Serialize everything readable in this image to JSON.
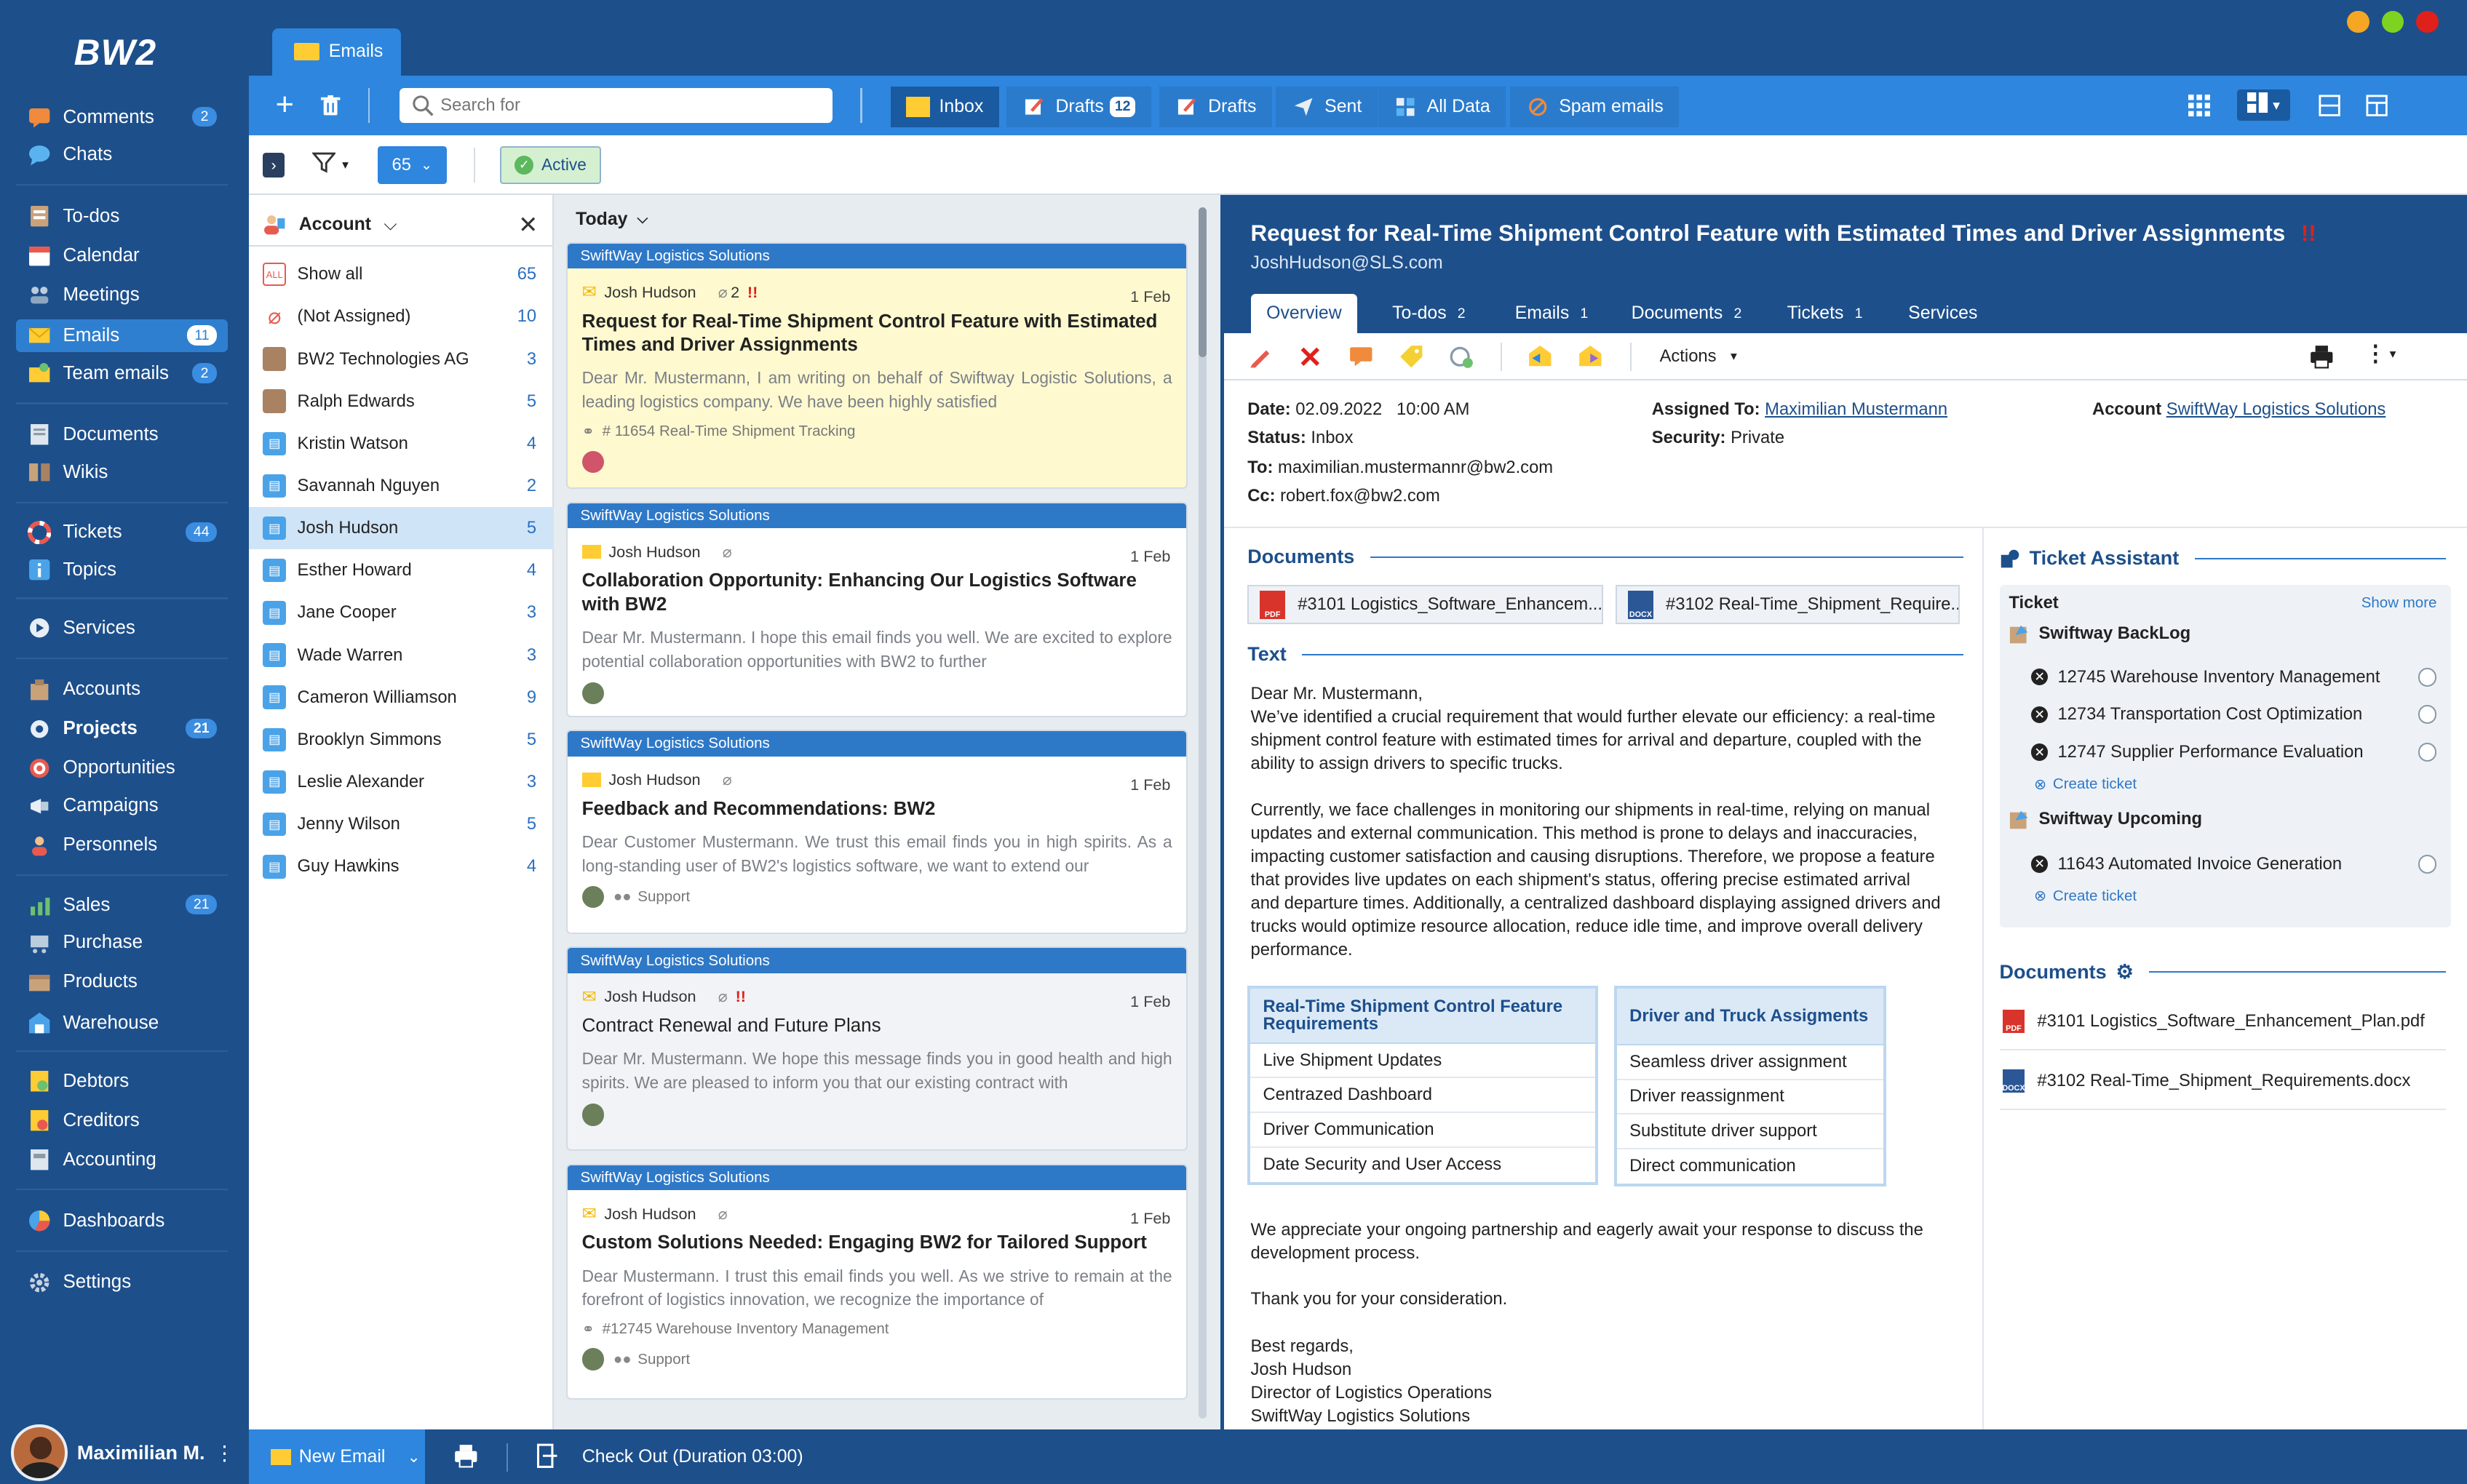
{
  "app": {
    "logo": "BW2",
    "window_tab": "Emails"
  },
  "sidebar": {
    "items": [
      {
        "label": "Comments",
        "count": "2"
      },
      {
        "label": "Chats",
        "count": ""
      },
      {
        "label": "To-dos",
        "count": ""
      },
      {
        "label": "Calendar",
        "count": ""
      },
      {
        "label": "Meetings",
        "count": ""
      },
      {
        "label": "Emails",
        "count": "11"
      },
      {
        "label": "Team emails",
        "count": "2"
      },
      {
        "label": "Documents",
        "count": ""
      },
      {
        "label": "Wikis",
        "count": ""
      },
      {
        "label": "Tickets",
        "count": "44"
      },
      {
        "label": "Topics",
        "count": ""
      },
      {
        "label": "Services",
        "count": ""
      },
      {
        "label": "Accounts",
        "count": ""
      },
      {
        "label": "Projects",
        "count": "21"
      },
      {
        "label": "Opportunities",
        "count": ""
      },
      {
        "label": "Campaigns",
        "count": ""
      },
      {
        "label": "Personnels",
        "count": ""
      },
      {
        "label": "Sales",
        "count": "21"
      },
      {
        "label": "Purchase",
        "count": ""
      },
      {
        "label": "Products",
        "count": ""
      },
      {
        "label": "Warehouse",
        "count": ""
      },
      {
        "label": "Debtors",
        "count": ""
      },
      {
        "label": "Creditors",
        "count": ""
      },
      {
        "label": "Accounting",
        "count": ""
      },
      {
        "label": "Dashboards",
        "count": ""
      },
      {
        "label": "Settings",
        "count": ""
      }
    ],
    "user": "Maximilian M."
  },
  "toolbar": {
    "search_placeholder": "Search for",
    "tabs": [
      {
        "label": "Inbox",
        "badge": ""
      },
      {
        "label": "Drafts",
        "badge": "12"
      },
      {
        "label": "Drafts",
        "badge": ""
      },
      {
        "label": "Sent",
        "badge": ""
      },
      {
        "label": "All Data",
        "badge": ""
      },
      {
        "label": "Spam emails",
        "badge": ""
      }
    ]
  },
  "filter": {
    "count": "65",
    "active_label": "Active"
  },
  "accounts": {
    "header": "Account",
    "rows": [
      {
        "label": "Show all",
        "count": "65"
      },
      {
        "label": "(Not Assigned)",
        "count": "10"
      },
      {
        "label": "BW2 Technologies AG",
        "count": "3"
      },
      {
        "label": "Ralph Edwards",
        "count": "5"
      },
      {
        "label": "Kristin Watson",
        "count": "4"
      },
      {
        "label": "Savannah Nguyen",
        "count": "2"
      },
      {
        "label": "Josh Hudson",
        "count": "5"
      },
      {
        "label": "Esther Howard",
        "count": "4"
      },
      {
        "label": "Jane Cooper",
        "count": "3"
      },
      {
        "label": "Wade Warren",
        "count": "3"
      },
      {
        "label": "Cameron Williamson",
        "count": "9"
      },
      {
        "label": "Brooklyn Simmons",
        "count": "5"
      },
      {
        "label": "Leslie Alexander",
        "count": "3"
      },
      {
        "label": "Jenny Wilson",
        "count": "5"
      },
      {
        "label": "Guy Hawkins",
        "count": "4"
      }
    ]
  },
  "list": {
    "group": "Today",
    "emails": [
      {
        "company": "SwiftWay Logistics Solutions",
        "from": "Josh Hudson",
        "attach": "2",
        "date": "1 Feb",
        "subject": "Request for Real-Time Shipment Control Feature with Estimated Times and Driver Assignments",
        "preview": "Dear Mr. Mustermann, I am writing on behalf of Swiftway Logistic Solutions, a leading logistics company. We have been highly satisfied",
        "meta": "# 11654 Real-Time Shipment Tracking"
      },
      {
        "company": "SwiftWay Logistics Solutions",
        "from": "Josh Hudson",
        "attach": "",
        "date": "1 Feb",
        "subject": "Collaboration Opportunity: Enhancing Our Logistics Software with BW2",
        "preview": "Dear Mr. Mustermann. I hope this email finds you well. We are excited to explore potential collaboration opportunities with BW2 to further",
        "meta": ""
      },
      {
        "company": "SwiftWay Logistics Solutions",
        "from": "Josh Hudson",
        "attach": "",
        "date": "1 Feb",
        "subject": "Feedback and Recommendations: BW2",
        "preview": "Dear Customer Mustermann. We trust this email finds you in high spirits. As a long-standing user of BW2's logistics software, we want to extend our",
        "meta": "Support"
      },
      {
        "company": "SwiftWay Logistics Solutions",
        "from": "Josh Hudson",
        "attach": "",
        "date": "1 Feb",
        "subject": "Contract Renewal and Future Plans",
        "preview": "Dear Mr. Mustermann. We hope this message finds you in good health and high spirits. We are pleased to inform you that our existing contract with",
        "meta": ""
      },
      {
        "company": "SwiftWay Logistics Solutions",
        "from": "Josh Hudson",
        "attach": "",
        "date": "1 Feb",
        "subject": "Custom Solutions Needed: Engaging BW2 for Tailored Support",
        "preview": "Dear Mustermann. I trust this email finds you well. As we strive to remain at the forefront of logistics innovation, we recognize the importance of",
        "meta": "#12745 Warehouse Inventory Management",
        "meta2": "Support"
      }
    ]
  },
  "detail": {
    "title": "Request for Real-Time Shipment Control Feature with Estimated Times and Driver Assignments",
    "from": "JoshHudson@SLS.com",
    "tabs": [
      {
        "label": "Overview",
        "count": ""
      },
      {
        "label": "To-dos",
        "count": "2"
      },
      {
        "label": "Emails",
        "count": "1"
      },
      {
        "label": "Documents",
        "count": "2"
      },
      {
        "label": "Tickets",
        "count": "1"
      },
      {
        "label": "Services",
        "count": ""
      }
    ],
    "actions_label": "Actions",
    "date_label": "Date:",
    "date": "02.09.2022   10:00 AM",
    "status_label": "Status:",
    "status": "Inbox",
    "to_label": "To:",
    "to": "maximilian.mustermannr@bw2.com",
    "cc_label": "Cc:",
    "cc": "robert.fox@bw2.com",
    "assigned_label": "Assigned To:",
    "assigned": "Maximilian Mustermann",
    "security_label": "Security:",
    "security": "Private",
    "account_label": "Account",
    "account": "SwiftWay Logistics Solutions",
    "documents_heading": "Documents",
    "doc1": "#3101 Logistics_Software_Enhancem...",
    "doc2": "#3102 Real-Time_Shipment_Require...",
    "text_heading": "Text",
    "para1": "Dear Mr. Mustermann,\nWe’ve identified a crucial requirement that would further elevate our efficiency: a real-time shipment control feature with estimated times for arrival and departure, coupled with the ability to assign drivers to specific trucks.",
    "para2": "Currently, we face challenges in monitoring our shipments in real-time, relying on manual updates and external communication. This method is prone to delays and inaccuracies, impacting customer satisfaction and causing disruptions. Therefore, we propose a feature that provides live updates on each shipment's status, offering precise estimated arrival and departure times. Additionally, a centralized dashboard displaying assigned drivers and trucks would optimize resource allocation, reduce idle time, and improve overall delivery performance.",
    "table1": {
      "header": "Real-Time Shipment Control Feature Requirements",
      "rows": [
        "Live Shipment Updates",
        "Centrazed Dashboard",
        "Driver Communication",
        "Date Security and User Access"
      ]
    },
    "table2": {
      "header": "Driver and Truck Assigments",
      "rows": [
        "Seamless driver assignment",
        "Driver reassignment",
        "Substitute driver support",
        "Direct communication"
      ]
    },
    "para3": "We appreciate your ongoing partnership and eagerly await your response to discuss the development process.",
    "para4": "Thank you for your consideration.",
    "para5": "Best regards,\nJosh Hudson\nDirector of Logistics Operations\nSwiftWay Logistics Solutions"
  },
  "assistant": {
    "heading": "Ticket Assistant",
    "ticket_label": "Ticket",
    "show_more": "Show more",
    "group1": "Swiftway BackLog",
    "g1_items": [
      "12745 Warehouse Inventory Management",
      "12734 Transportation Cost Optimization",
      "12747 Supplier Performance Evaluation"
    ],
    "create_ticket": "Create ticket",
    "group2": "Swiftway Upcoming",
    "g2_items": [
      "11643 Automated Invoice Generation"
    ],
    "docs_heading": "Documents",
    "docs": [
      "#3101 Logistics_Software_Enhancement_Plan.pdf",
      "#3102 Real-Time_Shipment_Requirements.docx"
    ]
  },
  "bottom": {
    "new_email": "New Email",
    "checkout": "Check Out (Duration 03:00)"
  }
}
